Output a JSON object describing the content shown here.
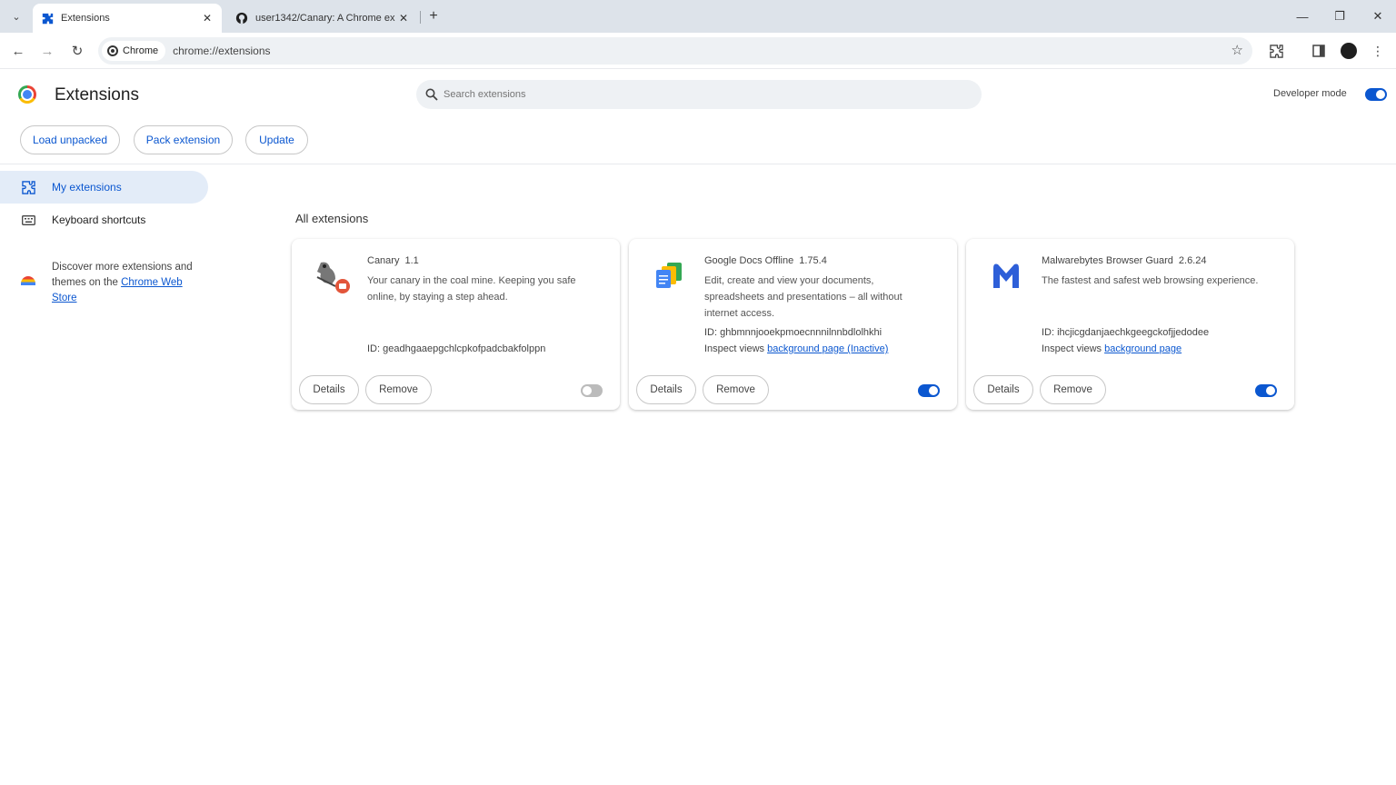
{
  "browser": {
    "tabs": [
      {
        "title": "Extensions",
        "icon": "puzzle-icon",
        "active": true
      },
      {
        "title": "user1342/Canary: A Chrome ex",
        "icon": "github-icon",
        "active": false
      }
    ],
    "address": {
      "chip_label": "Chrome",
      "url": "chrome://extensions"
    }
  },
  "header": {
    "title": "Extensions",
    "search_placeholder": "Search extensions",
    "developer_mode_label": "Developer mode",
    "developer_mode_on": true
  },
  "actions": {
    "load_unpacked": "Load unpacked",
    "pack_extension": "Pack extension",
    "update": "Update"
  },
  "sidebar": {
    "items": [
      {
        "label": "My extensions",
        "icon": "puzzle-icon",
        "active": true
      },
      {
        "label": "Keyboard shortcuts",
        "icon": "keyboard-icon",
        "active": false
      }
    ],
    "discover_prefix": "Discover more extensions and themes on the",
    "discover_link": "Chrome Web Store"
  },
  "main": {
    "section_title": "All extensions",
    "extensions": [
      {
        "name": "Canary",
        "version": "1.1",
        "description": "Your canary in the coal mine. Keeping you safe online, by staying a step ahead.",
        "id_label": "ID: geadhgaaepgchlcpkofpadcbakfolppn",
        "inspect_prefix": "",
        "inspect_link": "",
        "enabled": false,
        "details_label": "Details",
        "remove_label": "Remove"
      },
      {
        "name": "Google Docs Offline",
        "version": "1.75.4",
        "description": "Edit, create and view your documents, spreadsheets and presentations – all without internet access.",
        "id_label": "ID: ghbmnnjooekpmoecnnnilnnbdlolhkhi",
        "inspect_prefix": "Inspect views",
        "inspect_link": "background page (Inactive)",
        "enabled": true,
        "details_label": "Details",
        "remove_label": "Remove"
      },
      {
        "name": "Malwarebytes Browser Guard",
        "version": "2.6.24",
        "description": "The fastest and safest web browsing experience.",
        "id_label": "ID: ihcjicgdanjaechkgeegckofjjedodee",
        "inspect_prefix": "Inspect views",
        "inspect_link": "background page",
        "enabled": true,
        "details_label": "Details",
        "remove_label": "Remove"
      }
    ]
  },
  "colors": {
    "accent": "#0b57d0",
    "tabbar": "#dde3ea",
    "active_nav": "#e3ecf8"
  }
}
